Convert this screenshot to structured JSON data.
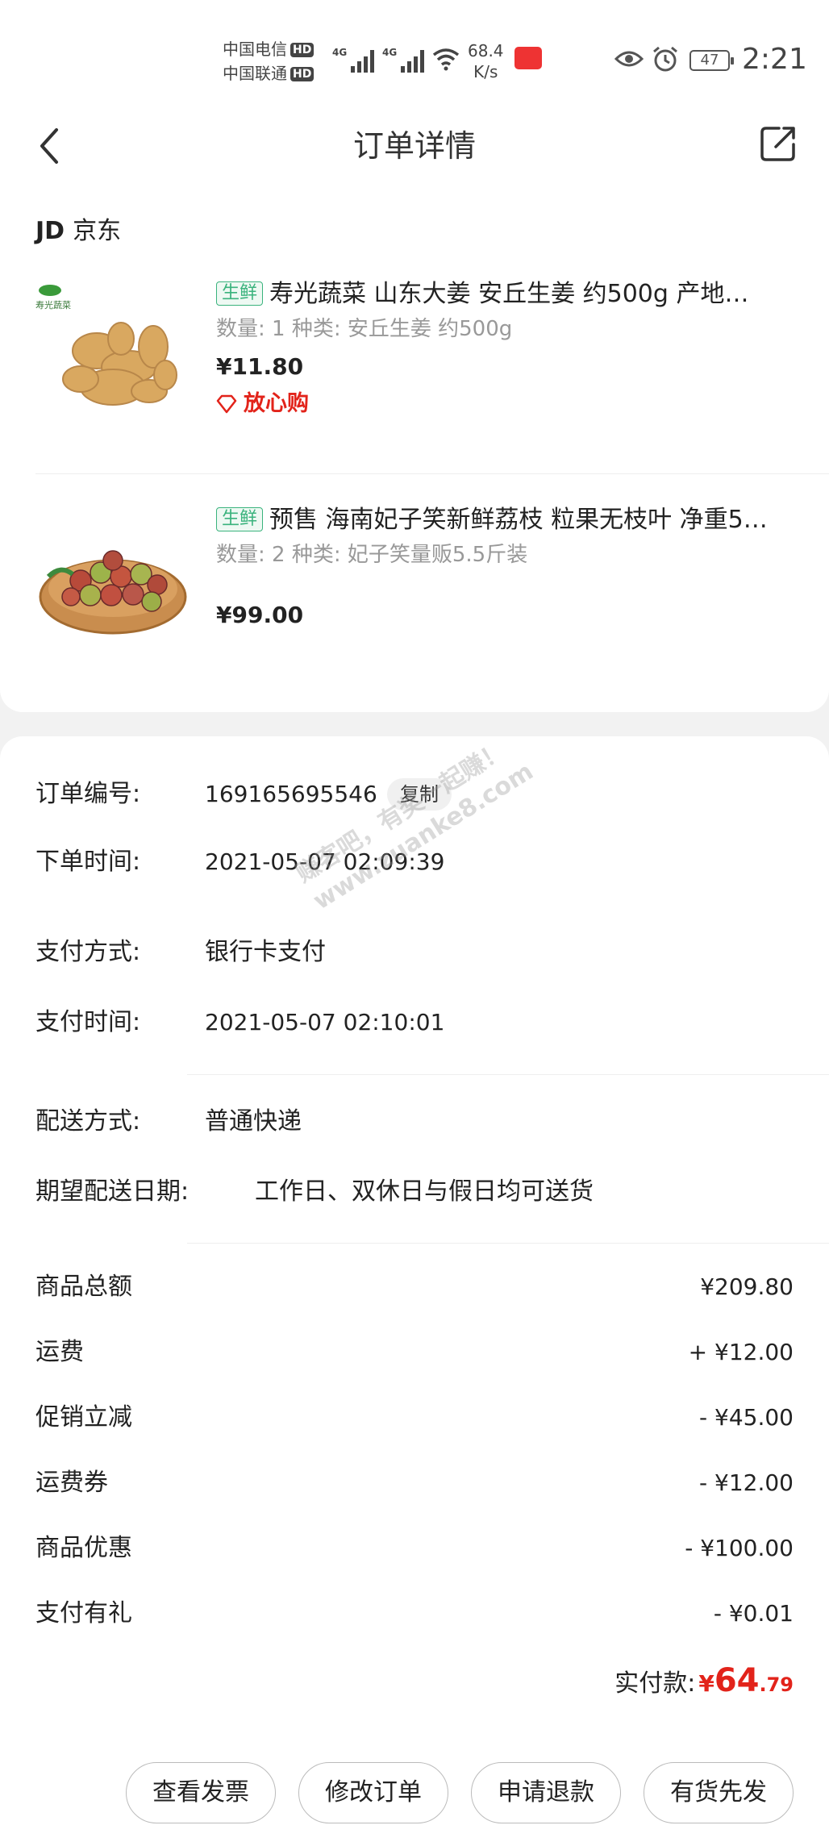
{
  "status_bar": {
    "carrier1": "中国电信",
    "carrier2": "中国联通",
    "hd": "HD",
    "net1": "4G",
    "net2": "4G",
    "speed_value": "68.4",
    "speed_unit": "K/s",
    "battery": "47",
    "time": "2:21"
  },
  "header": {
    "title": "订单详情"
  },
  "shop": {
    "logo": "JD",
    "name": "京东"
  },
  "products": [
    {
      "tag": "生鲜",
      "name": "寿光蔬菜 山东大姜 安丘生姜 约500g  产地…",
      "spec": "数量: 1  种类: 安丘生姜 约500g",
      "price": "¥11.80",
      "assurance": "放心购",
      "thumb_label": "寿光蔬菜"
    },
    {
      "tag": "生鲜",
      "name": "预售 海南妃子笑新鲜荔枝 粒果无枝叶 净重5…",
      "spec": "数量: 2  种类: 妃子笑量贩5.5斤装",
      "price": "¥99.00"
    }
  ],
  "order_info": {
    "order_no_label": "订单编号:",
    "order_no": "169165695546",
    "copy_label": "复制",
    "order_time_label": "下单时间:",
    "order_time": "2021-05-07 02:09:39",
    "pay_method_label": "支付方式:",
    "pay_method": "银行卡支付",
    "pay_time_label": "支付时间:",
    "pay_time": "2021-05-07 02:10:01",
    "ship_method_label": "配送方式:",
    "ship_method": "普通快递",
    "expected_date_label": "期望配送日期:",
    "expected_date": "工作日、双休日与假日均可送货"
  },
  "amounts": [
    {
      "label": "商品总额",
      "value": "¥209.80"
    },
    {
      "label": "运费",
      "value": "+ ¥12.00"
    },
    {
      "label": "促销立减",
      "value": "- ¥45.00"
    },
    {
      "label": "运费券",
      "value": "- ¥12.00"
    },
    {
      "label": "商品优惠",
      "value": "- ¥100.00"
    },
    {
      "label": "支付有礼",
      "value": "- ¥0.01"
    }
  ],
  "paid": {
    "label": "实付款:",
    "currency": "¥",
    "integer": "64",
    "decimal": ".79"
  },
  "watermark": {
    "line1": "赚客吧，有奖一起赚！",
    "line2": "www.zuanke8.com"
  },
  "actions": {
    "invoice": "查看发票",
    "modify": "修改订单",
    "refund": "申请退款",
    "ship_first": "有货先发"
  },
  "colors": {
    "accent_red": "#e2231a",
    "fresh_green": "#3ab37d"
  }
}
